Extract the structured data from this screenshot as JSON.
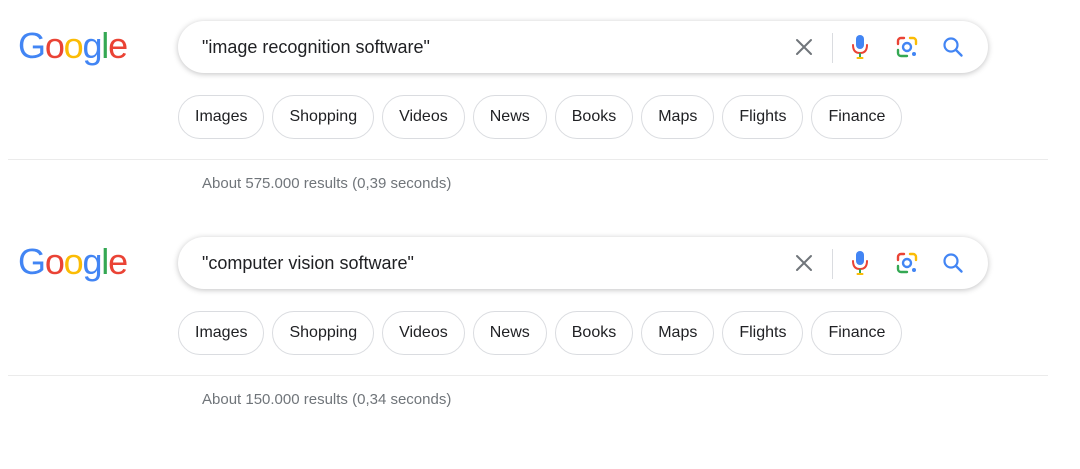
{
  "colors": {
    "blue": "#4285F4",
    "red": "#EA4335",
    "yellow": "#FBBC05",
    "green": "#34A853",
    "text": "#202124",
    "muted": "#70757a"
  },
  "logo": {
    "letters": [
      "G",
      "o",
      "o",
      "g",
      "l",
      "e"
    ],
    "colors": [
      "#4285F4",
      "#EA4335",
      "#FBBC05",
      "#4285F4",
      "#34A853",
      "#EA4335"
    ]
  },
  "icons": {
    "clear": "close-icon",
    "voice": "microphone-icon",
    "lens": "google-lens-icon",
    "search": "search-icon"
  },
  "searches": [
    {
      "query": "\"image recognition software\"",
      "chips": [
        "Images",
        "Shopping",
        "Videos",
        "News",
        "Books",
        "Maps",
        "Flights",
        "Finance"
      ],
      "result_stats": "About 575.000 results (0,39 seconds)"
    },
    {
      "query": "\"computer vision software\"",
      "chips": [
        "Images",
        "Shopping",
        "Videos",
        "News",
        "Books",
        "Maps",
        "Flights",
        "Finance"
      ],
      "result_stats": "About 150.000 results (0,34 seconds)"
    }
  ]
}
